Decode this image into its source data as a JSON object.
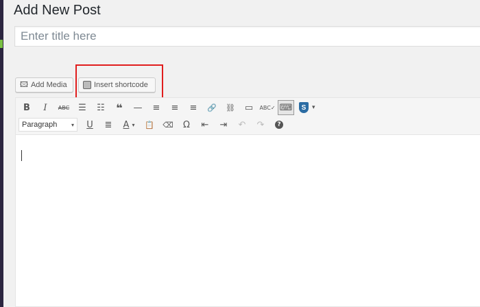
{
  "page": {
    "title": "Add New Post"
  },
  "title_input": {
    "placeholder": "Enter title here",
    "value": ""
  },
  "media_buttons": {
    "add_media": "Add Media",
    "insert_shortcode": "Insert shortcode"
  },
  "toolbar": {
    "row1": [
      {
        "name": "bold-button",
        "glyph": "B"
      },
      {
        "name": "italic-button",
        "glyph": "I"
      },
      {
        "name": "strikethrough-button",
        "glyph": "ABC"
      },
      {
        "name": "bulleted-list-button",
        "glyph": "☰"
      },
      {
        "name": "numbered-list-button",
        "glyph": "☷"
      },
      {
        "name": "blockquote-button",
        "glyph": "❝"
      },
      {
        "name": "horizontal-line-button",
        "glyph": "—"
      },
      {
        "name": "align-left-button",
        "glyph": "≡"
      },
      {
        "name": "align-center-button",
        "glyph": "≡"
      },
      {
        "name": "align-right-button",
        "glyph": "≡"
      },
      {
        "name": "insert-link-button",
        "glyph": "🔗"
      },
      {
        "name": "remove-link-button",
        "glyph": "⛓"
      },
      {
        "name": "read-more-button",
        "glyph": "▭"
      },
      {
        "name": "spellcheck-button",
        "glyph": "ABC✓"
      },
      {
        "name": "toolbar-toggle-button",
        "glyph": "⌨"
      }
    ],
    "format_select": "Paragraph",
    "row2": [
      {
        "name": "underline-button",
        "glyph": "U"
      },
      {
        "name": "justify-button",
        "glyph": "≣"
      },
      {
        "name": "text-color-button",
        "glyph": "A"
      },
      {
        "name": "paste-as-text-button",
        "glyph": "📋"
      },
      {
        "name": "clear-formatting-button",
        "glyph": "⌫"
      },
      {
        "name": "special-character-button",
        "glyph": "Ω"
      },
      {
        "name": "outdent-button",
        "glyph": "⇤"
      },
      {
        "name": "indent-button",
        "glyph": "⇥"
      },
      {
        "name": "undo-button",
        "glyph": "↶"
      },
      {
        "name": "redo-button",
        "glyph": "↷"
      },
      {
        "name": "help-button",
        "glyph": "?"
      }
    ],
    "shield_glyph": "S",
    "dropdown_glyph": "▾"
  },
  "colors": {
    "highlight": "#e01c1c",
    "admin_bar": "#2c2640",
    "shield": "#2b6ca3"
  }
}
